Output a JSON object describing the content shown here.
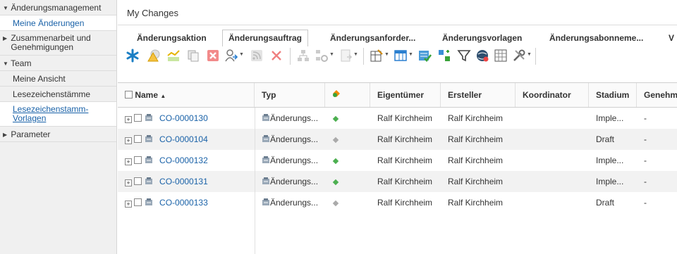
{
  "sidebar": {
    "items": [
      {
        "label": "Änderungsmanagement",
        "type": "header",
        "expanded": true
      },
      {
        "label": "Meine Änderungen",
        "type": "sub",
        "active": true
      },
      {
        "label": "Zusammenarbeit und Genehmigungen",
        "line1": "Zusammenarbeit und",
        "line2": "Genehmigungen",
        "type": "header-multi",
        "expanded": false
      },
      {
        "label": "Team",
        "type": "header",
        "expanded": true
      },
      {
        "label": "Meine Ansicht",
        "type": "sub"
      },
      {
        "label": "Lesezeichenstämme",
        "type": "sub"
      },
      {
        "label": "Lesezeichenstamm-Vorlagen",
        "line1": "Lesezeichenstamm-",
        "line2": "Vorlagen",
        "type": "link"
      },
      {
        "label": "Parameter",
        "type": "header",
        "expanded": false
      }
    ]
  },
  "main": {
    "title": "My Changes",
    "tabs": [
      {
        "label": "Änderungsaktion",
        "active": false
      },
      {
        "label": "Änderungsauftrag",
        "active": true
      },
      {
        "label": "Änderungsanforder...",
        "active": false
      },
      {
        "label": "Änderungsvorlagen",
        "active": false
      },
      {
        "label": "Änderungsabonneme...",
        "active": false
      },
      {
        "label": "V",
        "active": false
      }
    ],
    "toolbar_icons": [
      "asterisk-icon",
      "warning-gear-icon",
      "chart-icon",
      "copy-icon",
      "cancel-icon",
      "share-user-icon",
      "rss-icon",
      "delete-icon",
      "hierarchy-icon",
      "hierarchy-settings-icon",
      "page-icon",
      "edit-table-icon",
      "columns-icon",
      "approve-icon",
      "move-icon",
      "filter-icon",
      "globe-icon",
      "grid-icon",
      "tools-icon"
    ],
    "grid": {
      "columns": [
        "Name",
        "Typ",
        "",
        "Eigentümer",
        "Ersteller",
        "Koordinator",
        "Stadium",
        "Genehmi"
      ],
      "rows": [
        {
          "name": "CO-0000130",
          "typ": "Änderungs...",
          "status_color": "#4caf50",
          "owner": "Ralf Kirchheim",
          "creator": "Ralf Kirchheim",
          "coordinator": "",
          "stage": "Imple...",
          "approval": "-"
        },
        {
          "name": "CO-0000104",
          "typ": "Änderungs...",
          "status_color": "#aaaaaa",
          "owner": "Ralf Kirchheim",
          "creator": "Ralf Kirchheim",
          "coordinator": "",
          "stage": "Draft",
          "approval": "-"
        },
        {
          "name": "CO-0000132",
          "typ": "Änderungs...",
          "status_color": "#4caf50",
          "owner": "Ralf Kirchheim",
          "creator": "Ralf Kirchheim",
          "coordinator": "",
          "stage": "Imple...",
          "approval": "-"
        },
        {
          "name": "CO-0000131",
          "typ": "Änderungs...",
          "status_color": "#4caf50",
          "owner": "Ralf Kirchheim",
          "creator": "Ralf Kirchheim",
          "coordinator": "",
          "stage": "Imple...",
          "approval": "-"
        },
        {
          "name": "CO-0000133",
          "typ": "Änderungs...",
          "status_color": "#aaaaaa",
          "owner": "Ralf Kirchheim",
          "creator": "Ralf Kirchheim",
          "coordinator": "",
          "stage": "Draft",
          "approval": "-"
        }
      ]
    }
  },
  "colors": {
    "link": "#1a62a8",
    "active_green": "#4caf50",
    "inactive_gray": "#aaaaaa"
  }
}
